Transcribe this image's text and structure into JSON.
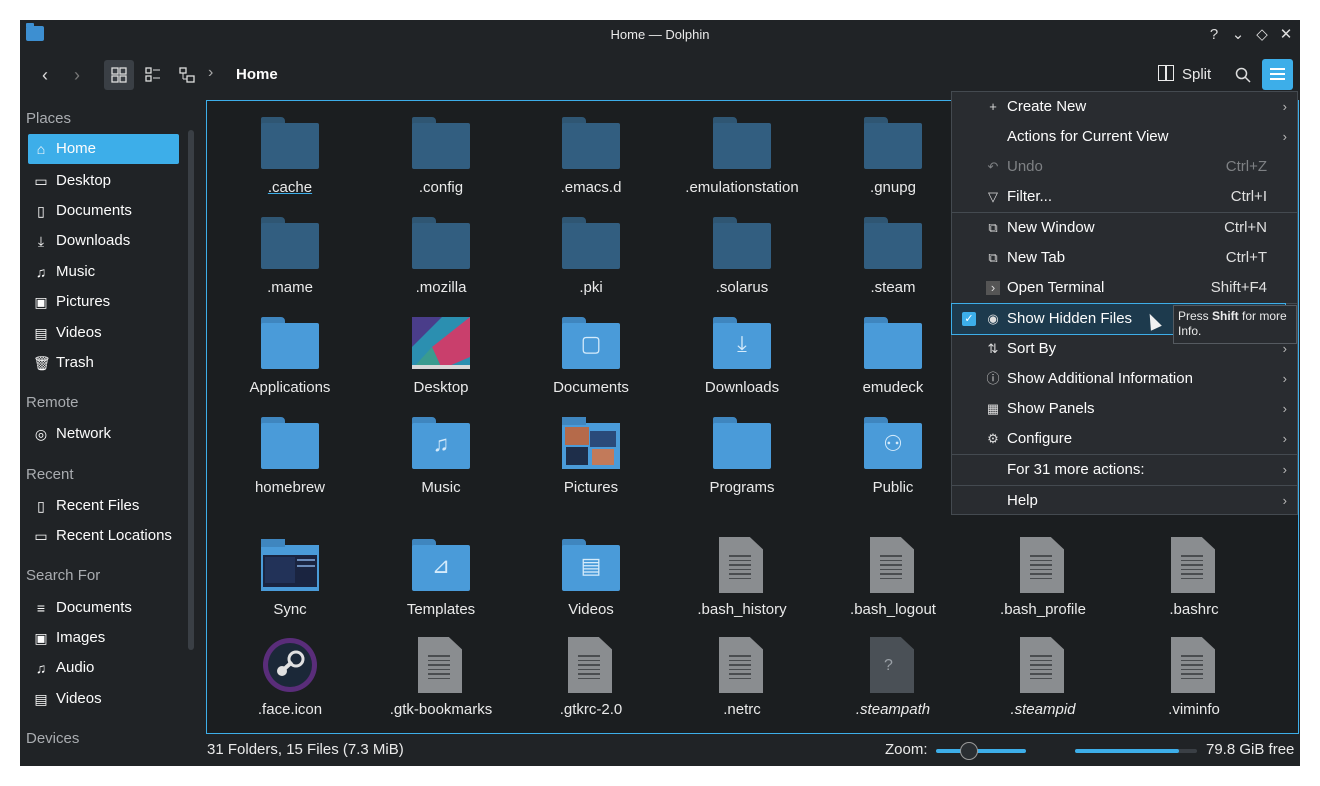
{
  "window": {
    "title": "Home — Dolphin"
  },
  "toolbar": {
    "breadcrumb": "Home",
    "split_label": "Split"
  },
  "sidebar": {
    "places_heading": "Places",
    "places": [
      "Home",
      "Desktop",
      "Documents",
      "Downloads",
      "Music",
      "Pictures",
      "Videos",
      "Trash"
    ],
    "remote_heading": "Remote",
    "remote": [
      "Network"
    ],
    "recent_heading": "Recent",
    "recent": [
      "Recent Files",
      "Recent Locations"
    ],
    "search_heading": "Search For",
    "search": [
      "Documents",
      "Images",
      "Audio",
      "Videos"
    ],
    "devices_heading": "Devices"
  },
  "files": {
    "row1": [
      ".cache",
      ".config",
      ".emacs.d",
      ".emulationstation",
      ".gnupg"
    ],
    "row2": [
      ".mame",
      ".mozilla",
      ".pki",
      ".solarus",
      ".steam"
    ],
    "row3": [
      "Applications",
      "Desktop",
      "Documents",
      "Downloads",
      "emudeck"
    ],
    "row4": [
      "homebrew",
      "Music",
      "Pictures",
      "Programs",
      "Public"
    ],
    "row5": [
      "Sync",
      "Templates",
      "Videos",
      ".bash_history",
      ".bash_logout",
      ".bash_profile",
      ".bashrc"
    ],
    "row6": [
      ".face.icon",
      ".gtk-bookmarks",
      ".gtkrc-2.0",
      ".netrc",
      ".steampath",
      ".steampid",
      ".viminfo"
    ]
  },
  "menu": {
    "create_new": "Create New",
    "actions_current_view": "Actions for Current View",
    "undo": "Undo",
    "undo_sc": "Ctrl+Z",
    "filter": "Filter...",
    "filter_sc": "Ctrl+I",
    "new_window": "New Window",
    "new_window_sc": "Ctrl+N",
    "new_tab": "New Tab",
    "new_tab_sc": "Ctrl+T",
    "open_terminal": "Open Terminal",
    "open_terminal_sc": "Shift+F4",
    "show_hidden": "Show Hidden Files",
    "sort_by": "Sort By",
    "show_additional": "Show Additional Information",
    "show_panels": "Show Panels",
    "configure": "Configure",
    "more_actions": "For 31 more actions:",
    "help": "Help"
  },
  "tooltip": {
    "pre": "Press ",
    "key": "Shift",
    "post": " for more Info."
  },
  "status": {
    "summary": "31 Folders, 15 Files (7.3 MiB)",
    "zoom_label": "Zoom:",
    "zoom_level": 0.35,
    "free_space": "79.8 GiB free",
    "disk_used_fraction": 0.85
  }
}
